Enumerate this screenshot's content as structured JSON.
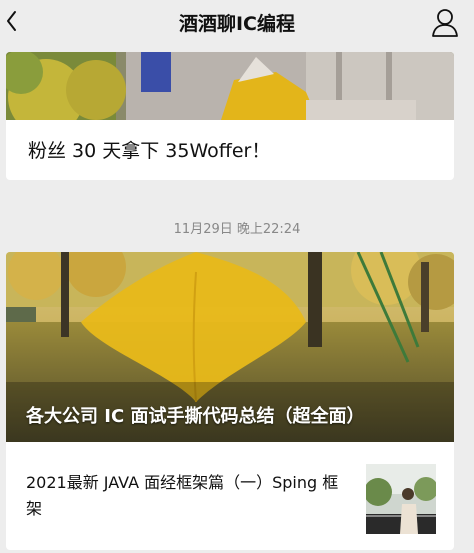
{
  "header": {
    "title": "酒酒聊IC编程",
    "back_icon": "chevron-left-icon",
    "profile_icon": "person-icon"
  },
  "articles": [
    {
      "caption": "粉丝 30 天拿下 35Woffer！"
    }
  ],
  "timestamp": "11月29日 晚上22:24",
  "feature": {
    "headline": "各大公司 IC 面试手撕代码总结（超全面）",
    "sub_article": "2021最新 JAVA 面经框架篇（一）Sping 框架"
  }
}
